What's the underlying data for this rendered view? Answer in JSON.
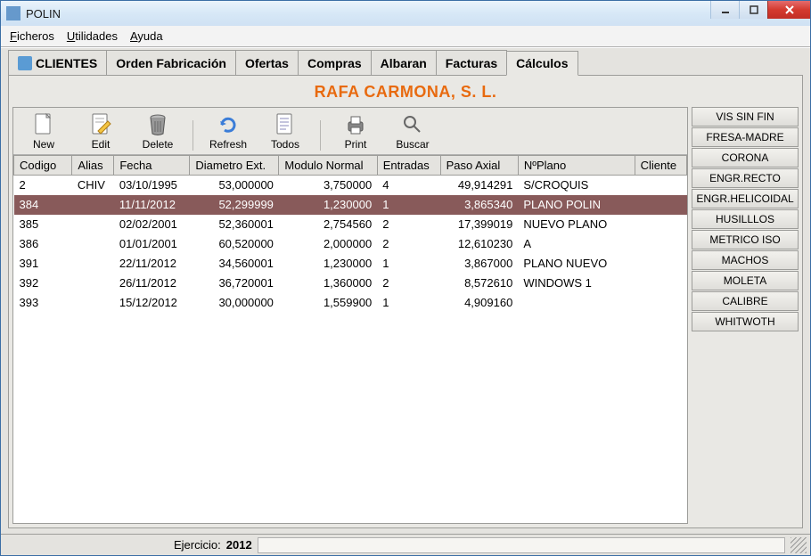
{
  "window": {
    "title": "POLIN"
  },
  "menu": {
    "ficheros": "Ficheros",
    "utilidades": "Utilidades",
    "ayuda": "Ayuda"
  },
  "tabs": [
    {
      "label": "CLIENTES"
    },
    {
      "label": "Orden Fabricación"
    },
    {
      "label": "Ofertas"
    },
    {
      "label": "Compras"
    },
    {
      "label": "Albaran"
    },
    {
      "label": "Facturas"
    },
    {
      "label": "Cálculos"
    }
  ],
  "active_tab": 6,
  "company": "RAFA CARMONA, S. L.",
  "toolbar": {
    "new": "New",
    "edit": "Edit",
    "delete": "Delete",
    "refresh": "Refresh",
    "todos": "Todos",
    "print": "Print",
    "buscar": "Buscar"
  },
  "columns": [
    "Codigo",
    "Alias",
    "Fecha",
    "Diametro Ext.",
    "Modulo Normal",
    "Entradas",
    "Paso Axial",
    "NºPlano",
    "Cliente"
  ],
  "rows": [
    {
      "codigo": "2",
      "alias": "CHIV",
      "fecha": "03/10/1995",
      "diam": "53,000000",
      "mod": "3,750000",
      "ent": "4",
      "paso": "49,914291",
      "plano": "S/CROQUIS",
      "cliente": "",
      "selected": false
    },
    {
      "codigo": "384",
      "alias": "",
      "fecha": "11/11/2012",
      "diam": "52,299999",
      "mod": "1,230000",
      "ent": "1",
      "paso": "3,865340",
      "plano": "PLANO POLIN",
      "cliente": "",
      "selected": true
    },
    {
      "codigo": "385",
      "alias": "",
      "fecha": "02/02/2001",
      "diam": "52,360001",
      "mod": "2,754560",
      "ent": "2",
      "paso": "17,399019",
      "plano": "NUEVO PLANO",
      "cliente": "",
      "selected": false
    },
    {
      "codigo": "386",
      "alias": "",
      "fecha": "01/01/2001",
      "diam": "60,520000",
      "mod": "2,000000",
      "ent": "2",
      "paso": "12,610230",
      "plano": "A",
      "cliente": "",
      "selected": false
    },
    {
      "codigo": "391",
      "alias": "",
      "fecha": "22/11/2012",
      "diam": "34,560001",
      "mod": "1,230000",
      "ent": "1",
      "paso": "3,867000",
      "plano": "PLANO NUEVO",
      "cliente": "",
      "selected": false
    },
    {
      "codigo": "392",
      "alias": "",
      "fecha": "26/11/2012",
      "diam": "36,720001",
      "mod": "1,360000",
      "ent": "2",
      "paso": "8,572610",
      "plano": "WINDOWS 1",
      "cliente": "",
      "selected": false
    },
    {
      "codigo": "393",
      "alias": "",
      "fecha": "15/12/2012",
      "diam": "30,000000",
      "mod": "1,559900",
      "ent": "1",
      "paso": "4,909160",
      "plano": "",
      "cliente": "",
      "selected": false
    }
  ],
  "sidebar": [
    "VIS SIN FIN",
    "FRESA-MADRE",
    "CORONA",
    "ENGR.RECTO",
    "ENGR.HELICOIDAL",
    "HUSILLLOS",
    "METRICO ISO",
    "MACHOS",
    "MOLETA",
    "CALIBRE",
    "WHITWOTH"
  ],
  "statusbar": {
    "label": "Ejercicio:",
    "value": "2012"
  }
}
